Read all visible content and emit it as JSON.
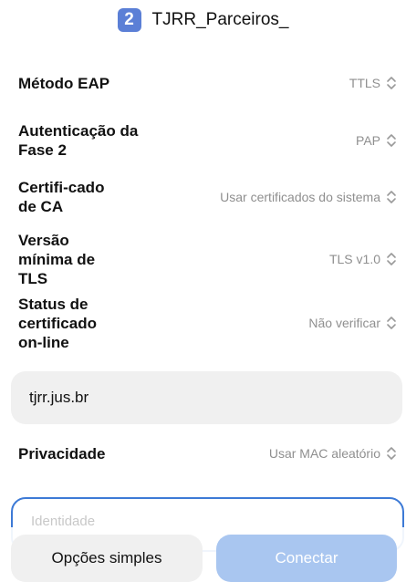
{
  "header": {
    "sim_number": "2",
    "network_name": "TJRR_Parceiros_"
  },
  "settings": {
    "eap_method": {
      "label": "Método EAP",
      "value": "TTLS"
    },
    "phase2_auth": {
      "label": "Autenticação da Fase 2",
      "value": "PAP"
    },
    "ca_certificate": {
      "label": "Certifi-cado de CA",
      "value": "Usar certificados do sistema"
    },
    "min_tls": {
      "label": "Versão mínima de TLS",
      "value": "TLS v1.0"
    },
    "ocsp_status": {
      "label": "Status de certificado on-line",
      "value": "Não verificar"
    },
    "domain": {
      "value": "tjrr.jus.br"
    },
    "privacy": {
      "label": "Privacidade",
      "value": "Usar MAC aleatório"
    },
    "identity": {
      "placeholder": "Identidade"
    }
  },
  "buttons": {
    "simple_options": "Opções simples",
    "connect": "Conectar"
  },
  "colors": {
    "accent": "#3d7ad6",
    "badge": "#5b7fd6",
    "connect_disabled": "#a9c6f0",
    "field_bg": "#f0f0f0",
    "value_text": "#8f8f8f"
  }
}
